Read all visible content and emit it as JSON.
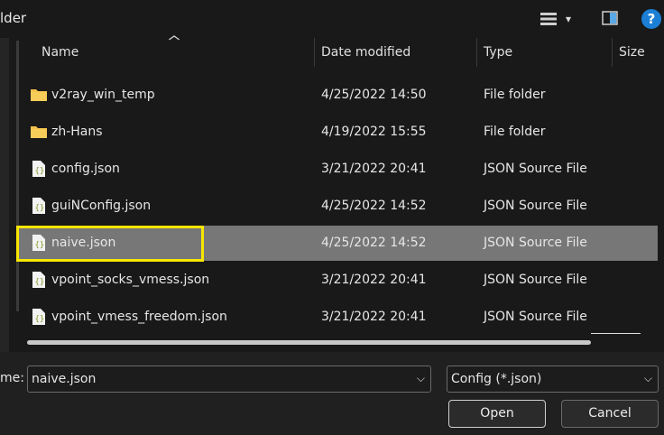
{
  "dialog": {
    "title_fragment": "lder"
  },
  "toolbar": {
    "view_caret": "▾",
    "help_label": "?"
  },
  "columns": {
    "name": "Name",
    "date_modified": "Date modified",
    "type": "Type",
    "size": "Size"
  },
  "files": [
    {
      "name": "v2ray_win_temp",
      "date": "4/25/2022 14:50",
      "type": "File folder",
      "kind": "folder"
    },
    {
      "name": "zh-Hans",
      "date": "4/19/2022 15:55",
      "type": "File folder",
      "kind": "folder"
    },
    {
      "name": "config.json",
      "date": "3/21/2022 20:41",
      "type": "JSON Source File",
      "kind": "json"
    },
    {
      "name": "guiNConfig.json",
      "date": "4/25/2022 14:52",
      "type": "JSON Source File",
      "kind": "json"
    },
    {
      "name": "naive.json",
      "date": "4/25/2022 14:52",
      "type": "JSON Source File",
      "kind": "json",
      "selected": true
    },
    {
      "name": "vpoint_socks_vmess.json",
      "date": "3/21/2022 20:41",
      "type": "JSON Source File",
      "kind": "json"
    },
    {
      "name": "vpoint_vmess_freedom.json",
      "date": "3/21/2022 20:41",
      "type": "JSON Source File",
      "kind": "json"
    }
  ],
  "filename": {
    "label": "me:",
    "value": "naive.json"
  },
  "filetype": {
    "value": "Config (*.json)"
  },
  "buttons": {
    "open": "Open",
    "cancel": "Cancel"
  },
  "colors": {
    "highlight": "#f7e600",
    "selected_row": "#777777",
    "folder": "#f5c24b",
    "help": "#1b7fd6"
  }
}
